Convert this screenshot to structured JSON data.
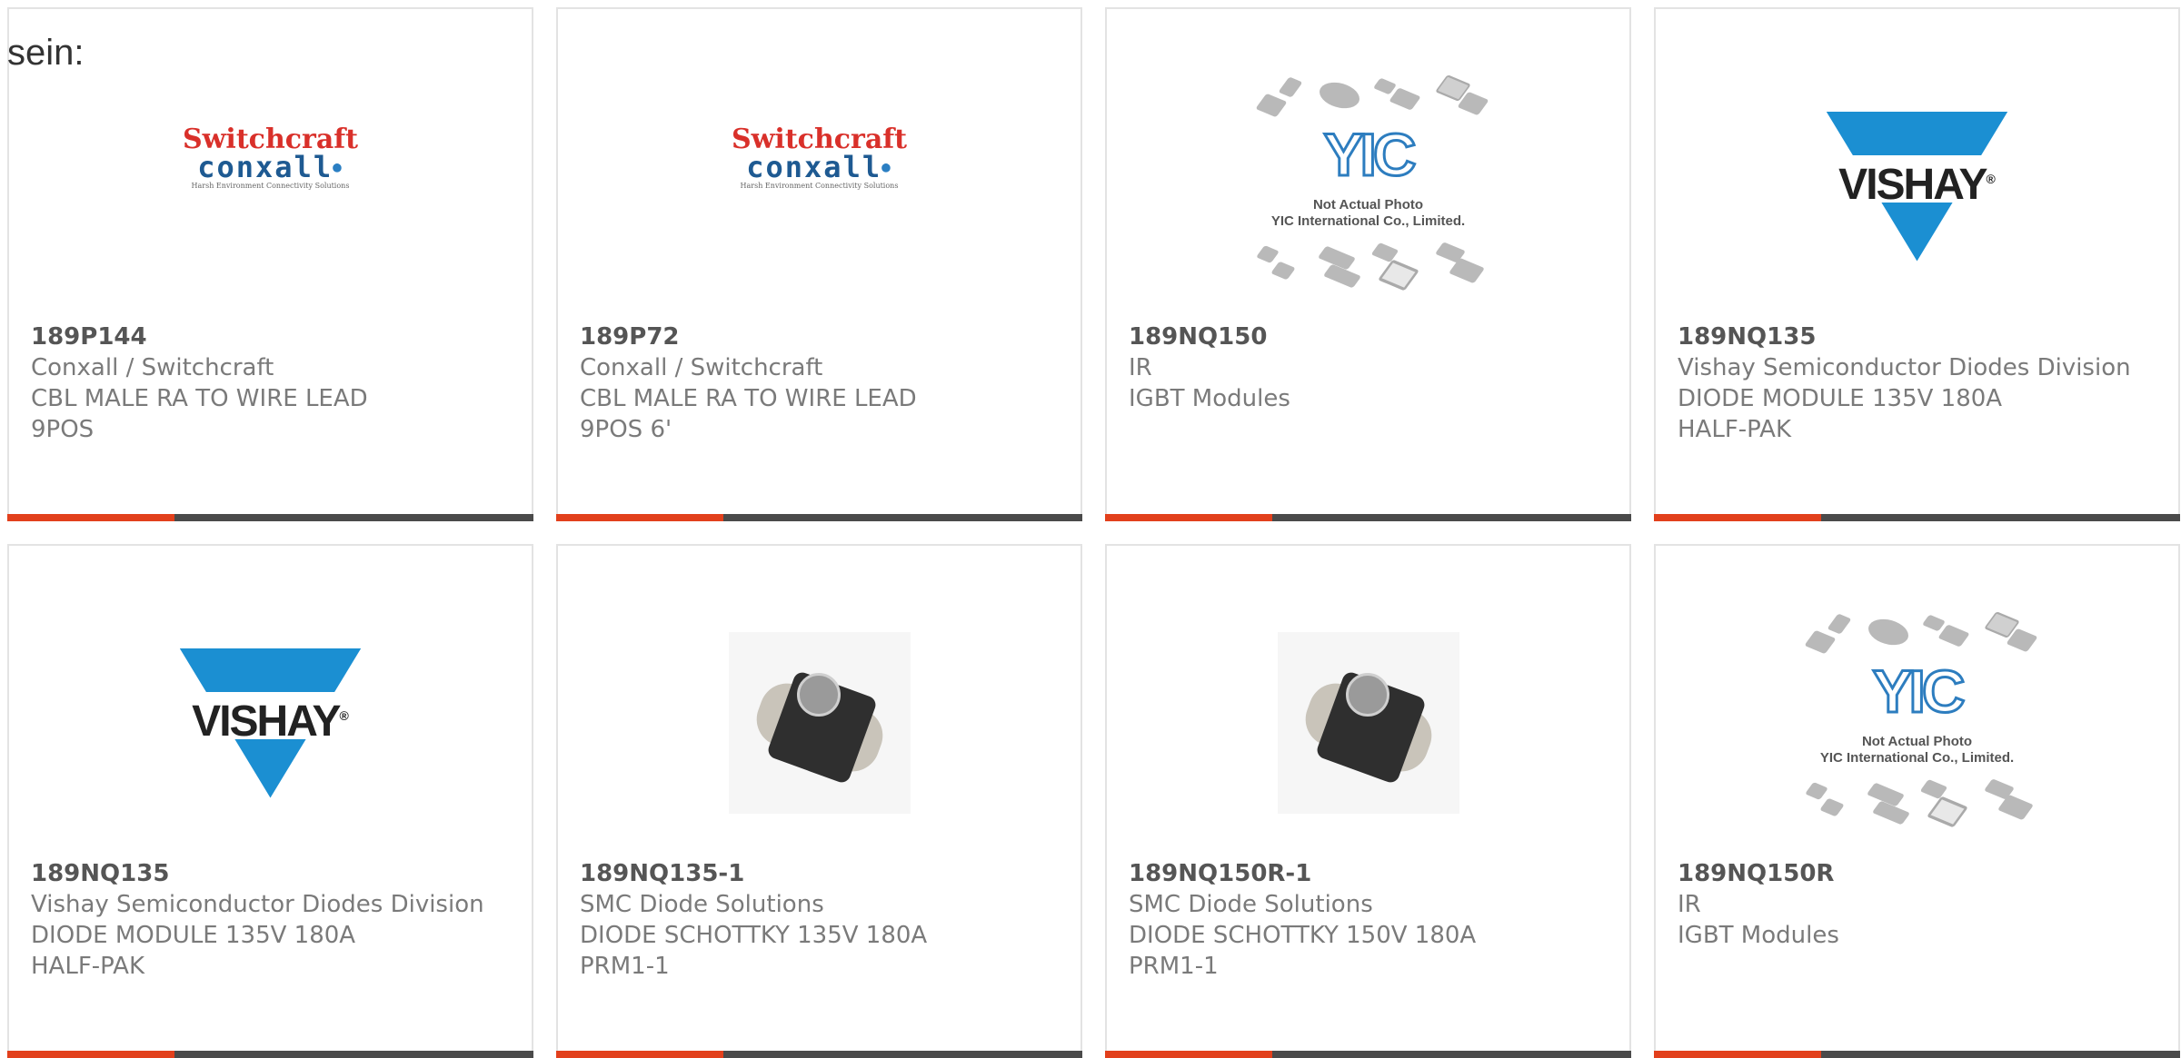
{
  "intro_text": "sein:",
  "products": [
    {
      "part": "189P144",
      "maker": "Conxall / Switchcraft",
      "desc": [
        "CBL MALE RA TO WIRE LEAD",
        "9POS"
      ],
      "image": "switchcraft-conxall-logo"
    },
    {
      "part": "189P72",
      "maker": "Conxall / Switchcraft",
      "desc": [
        "CBL MALE RA TO WIRE LEAD",
        "9POS 6'"
      ],
      "image": "switchcraft-conxall-logo"
    },
    {
      "part": "189NQ150",
      "maker": "IR",
      "desc": [
        "IGBT Modules"
      ],
      "image": "yic-placeholder"
    },
    {
      "part": "189NQ135",
      "maker": "Vishay Semiconductor Diodes Division",
      "desc": [
        "DIODE MODULE 135V 180A",
        "HALF-PAK"
      ],
      "image": "vishay-logo"
    },
    {
      "part": "189NQ135",
      "maker": "Vishay Semiconductor Diodes Division",
      "desc": [
        "DIODE MODULE 135V 180A",
        "HALF-PAK"
      ],
      "image": "vishay-logo"
    },
    {
      "part": "189NQ135-1",
      "maker": "SMC Diode Solutions",
      "desc": [
        "DIODE SCHOTTKY 135V 180A",
        "PRM1-1"
      ],
      "image": "diode-module-photo"
    },
    {
      "part": "189NQ150R-1",
      "maker": "SMC Diode Solutions",
      "desc": [
        "DIODE SCHOTTKY 150V 180A",
        "PRM1-1"
      ],
      "image": "diode-module-photo"
    },
    {
      "part": "189NQ150R",
      "maker": "IR",
      "desc": [
        "IGBT Modules"
      ],
      "image": "yic-placeholder"
    }
  ],
  "logos": {
    "switchcraft_line1": "Switchcraft",
    "switchcraft_line2": "conxall",
    "switchcraft_tagline": "Harsh Environment Connectivity Solutions",
    "vishay_word": "VISHAY",
    "yic_mark": "YIC",
    "yic_caption_1": "Not Actual Photo",
    "yic_caption_2": "YIC International Co., Limited."
  },
  "colors": {
    "accent_bar": "#e2401c",
    "dark_bar": "#4a4a4a",
    "vishay_blue": "#1b8fd2"
  }
}
